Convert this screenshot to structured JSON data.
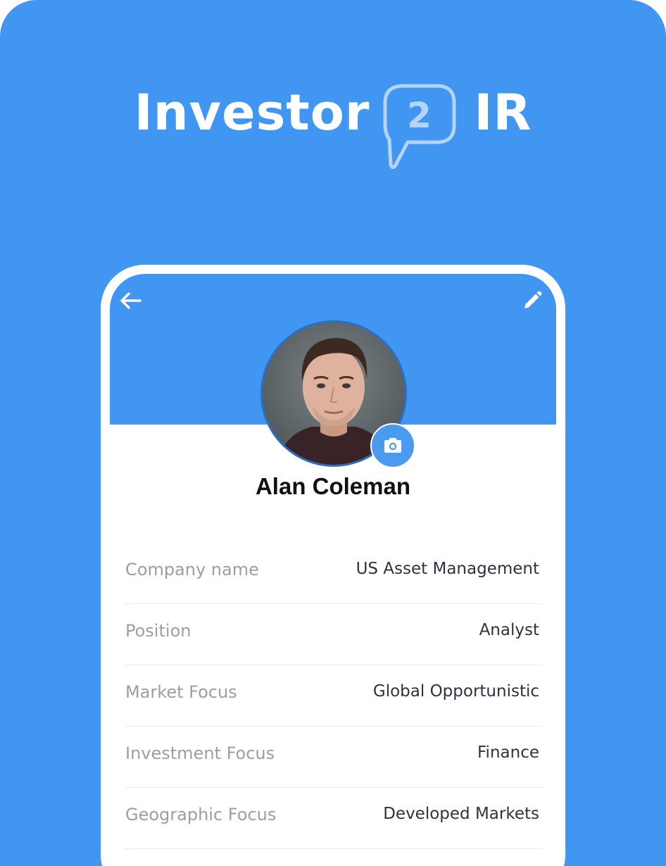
{
  "brand": {
    "word_left": "Investor",
    "bubble_number": "2",
    "word_right": "IR",
    "background_color": "#4096f0"
  },
  "toolbar": {
    "back_icon": "arrow-left-icon",
    "edit_icon": "pencil-icon"
  },
  "profile": {
    "name": "Alan Coleman",
    "camera_icon": "camera-icon"
  },
  "details": [
    {
      "label": "Company name",
      "value": "US Asset Management"
    },
    {
      "label": "Position",
      "value": "Analyst"
    },
    {
      "label": "Market Focus",
      "value": "Global Opportunistic"
    },
    {
      "label": "Investment Focus",
      "value": "Finance"
    },
    {
      "label": "Geographic Focus",
      "value": "Developed Markets"
    }
  ]
}
